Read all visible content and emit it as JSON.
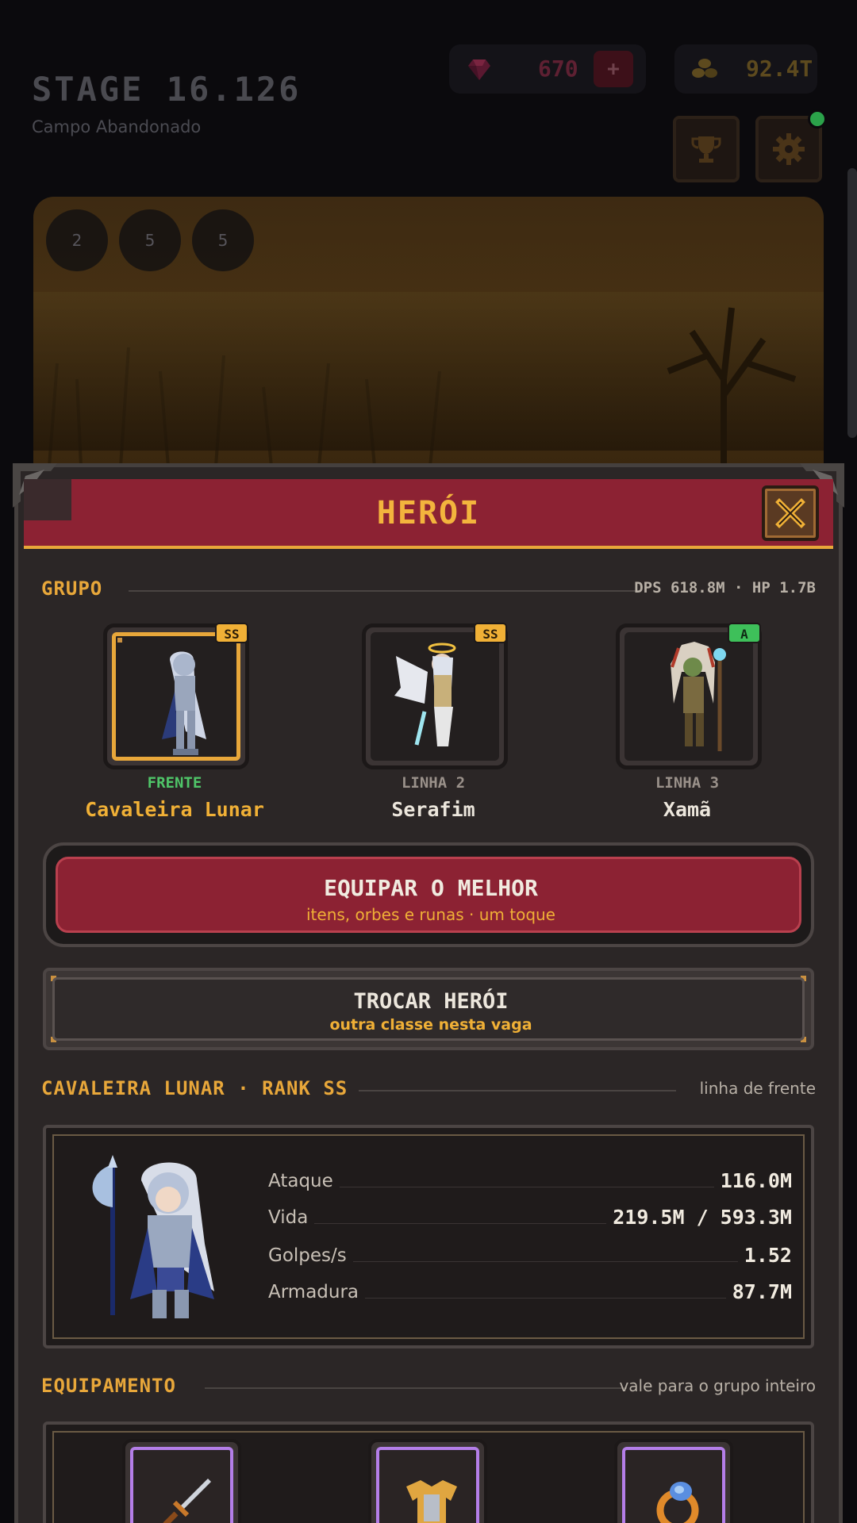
{
  "hud": {
    "stage_title": "STAGE 16.126",
    "stage_subtitle": "Campo Abandonado",
    "gems": "670",
    "gems_plus": "+",
    "gold": "92.4T"
  },
  "buffs": [
    "2",
    "5",
    "5"
  ],
  "modal": {
    "title": "HERÓI",
    "group_label": "GRUPO",
    "group_stats": "DPS 618.8M · HP 1.7B",
    "heroes": [
      {
        "rank": "SS",
        "role": "FRENTE",
        "name": "Cavaleira Lunar"
      },
      {
        "rank": "SS",
        "role": "LINHA 2",
        "name": "Serafim"
      },
      {
        "rank": "A",
        "role": "LINHA 3",
        "name": "Xamã"
      }
    ],
    "equip_best": {
      "label": "EQUIPAR O MELHOR",
      "sub": "itens, orbes e runas · um toque"
    },
    "swap_hero": {
      "label": "TROCAR HERÓI",
      "sub": "outra classe nesta vaga"
    },
    "hero_section": {
      "label": "CAVALEIRA LUNAR · RANK SS",
      "right": "linha de frente"
    },
    "stats": [
      {
        "label": "Ataque",
        "value": "116.0M"
      },
      {
        "label": "Vida",
        "value": "219.5M / 593.3M"
      },
      {
        "label": "Golpes/s",
        "value": "1.52"
      },
      {
        "label": "Armadura",
        "value": "87.7M"
      }
    ],
    "equipment_section": {
      "label": "EQUIPAMENTO",
      "right": "vale para o grupo inteiro"
    },
    "equipment_icons": [
      "sword-icon",
      "armor-icon",
      "ring-icon"
    ]
  },
  "colors": {
    "accent_gold": "#e8a73a",
    "accent_red": "#8c2233",
    "rank_ss": "#f0b036",
    "rank_a": "#3ec05a",
    "front_green": "#4fc468",
    "epic_purple": "#b47ee8"
  }
}
